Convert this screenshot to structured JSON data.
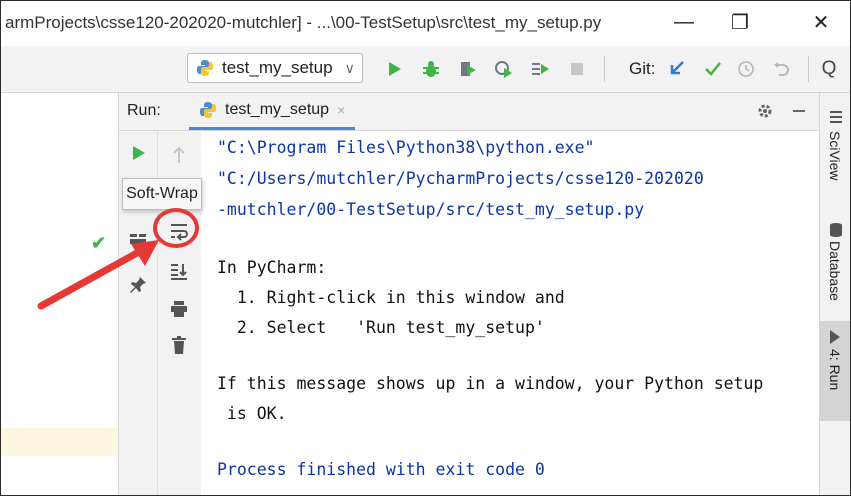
{
  "window": {
    "title": "armProjects\\csse120-202020-mutchler] - ...\\00-TestSetup\\src\\test_my_setup.py",
    "minimize_icon": "—",
    "restore_icon": "❐",
    "close_icon": "✕"
  },
  "toolbar": {
    "run_config": "test_my_setup",
    "dropdown_icon": "∨",
    "git_label": "Git:",
    "search_glyph": "Q"
  },
  "run_window": {
    "label": "Run:",
    "tab_label": "test_my_setup",
    "tab_close": "×"
  },
  "tooltip": {
    "text": "Soft-Wrap"
  },
  "console": {
    "lines": [
      "\"C:\\Program Files\\Python38\\python.exe\"",
      "\"C:/Users/mutchler/PycharmProjects/csse120-202020",
      "-mutchler/00-TestSetup/src/test_my_setup.py",
      "In PyCharm:",
      "  1. Right-click in this window and",
      "  2. Select   'Run test_my_setup'",
      "If this message shows up in a window, your Python setup",
      " is OK.",
      "Process finished with exit code 0"
    ]
  },
  "right_stripe": {
    "sciview": "SciView",
    "database": "Database",
    "run": "4: Run"
  },
  "colors": {
    "accent_blue": "#4a86c8",
    "console_blue": "#0b35a8",
    "run_green": "#3fb449",
    "annotation_red": "#e53935"
  }
}
